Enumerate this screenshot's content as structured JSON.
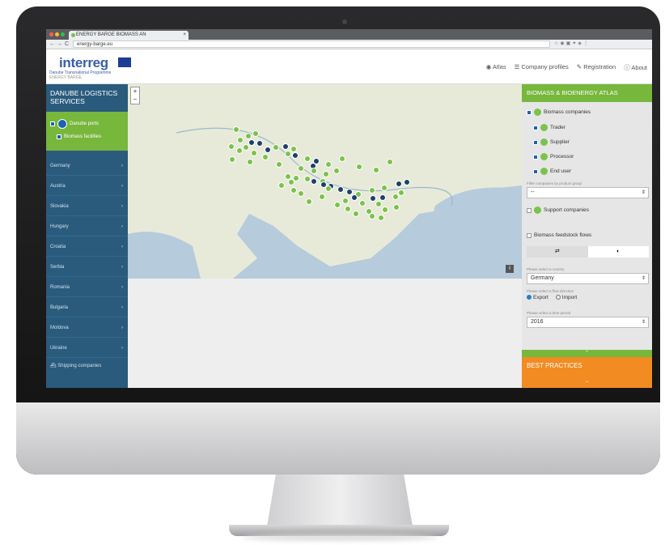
{
  "browser": {
    "tab_title": "ENERGY BARGE BIOMASS AN",
    "tab_close": "×",
    "url": "energy-barge.eu",
    "back": "←",
    "forward": "→",
    "reload": "C"
  },
  "header": {
    "logo_word": "interreg",
    "logo_program": "Danube Transnational Programme",
    "logo_project": "ENERGY BARGE",
    "nav": [
      {
        "icon": "globe-icon",
        "glyph": "◉",
        "label": "Atlas"
      },
      {
        "icon": "list-icon",
        "glyph": "☰",
        "label": "Company profiles"
      },
      {
        "icon": "edit-icon",
        "glyph": "✎",
        "label": "Registration"
      },
      {
        "icon": "info-icon",
        "glyph": "ⓘ",
        "label": "About"
      }
    ]
  },
  "left_sidebar": {
    "title": "DANUBE LOGISTICS SERVICES",
    "layers": [
      {
        "label": "Danube ports",
        "checked": true
      },
      {
        "label": "Biomass facilities",
        "checked": true
      }
    ],
    "countries": [
      "Germany",
      "Austria",
      "Slovakia",
      "Hungary",
      "Croatia",
      "Serbia",
      "Romania",
      "Bulgaria",
      "Moldova",
      "Ukraine"
    ],
    "arrow": "›",
    "shipping_label": "Shipping companies"
  },
  "map": {
    "zoom_in": "+",
    "zoom_out": "−",
    "info": "i",
    "markers": [
      {
        "lat": 50.6,
        "lon": 11.0,
        "type": "green"
      },
      {
        "lat": 50.2,
        "lon": 13.0,
        "type": "green"
      },
      {
        "lat": 49.9,
        "lon": 12.2,
        "type": "green"
      },
      {
        "lat": 49.5,
        "lon": 11.4,
        "type": "green"
      },
      {
        "lat": 49.3,
        "lon": 12.6,
        "type": "blue"
      },
      {
        "lat": 49.2,
        "lon": 13.4,
        "type": "blue"
      },
      {
        "lat": 48.8,
        "lon": 12.0,
        "type": "green"
      },
      {
        "lat": 48.9,
        "lon": 10.5,
        "type": "green"
      },
      {
        "lat": 48.5,
        "lon": 11.3,
        "type": "green"
      },
      {
        "lat": 48.3,
        "lon": 12.8,
        "type": "green"
      },
      {
        "lat": 48.6,
        "lon": 14.2,
        "type": "blue"
      },
      {
        "lat": 48.8,
        "lon": 15.0,
        "type": "green"
      },
      {
        "lat": 48.9,
        "lon": 16.0,
        "type": "blue"
      },
      {
        "lat": 48.7,
        "lon": 16.8,
        "type": "green"
      },
      {
        "lat": 48.2,
        "lon": 16.3,
        "type": "green"
      },
      {
        "lat": 48.0,
        "lon": 17.0,
        "type": "blue"
      },
      {
        "lat": 47.9,
        "lon": 14.0,
        "type": "green"
      },
      {
        "lat": 47.6,
        "lon": 10.6,
        "type": "green"
      },
      {
        "lat": 47.4,
        "lon": 12.4,
        "type": "green"
      },
      {
        "lat": 47.2,
        "lon": 15.4,
        "type": "green"
      },
      {
        "lat": 47.7,
        "lon": 18.2,
        "type": "green"
      },
      {
        "lat": 47.5,
        "lon": 19.1,
        "type": "blue"
      },
      {
        "lat": 47.2,
        "lon": 20.4,
        "type": "green"
      },
      {
        "lat": 47.7,
        "lon": 21.8,
        "type": "green"
      },
      {
        "lat": 47.0,
        "lon": 18.8,
        "type": "blue"
      },
      {
        "lat": 46.8,
        "lon": 17.6,
        "type": "green"
      },
      {
        "lat": 46.5,
        "lon": 18.9,
        "type": "green"
      },
      {
        "lat": 46.2,
        "lon": 20.1,
        "type": "green"
      },
      {
        "lat": 46.5,
        "lon": 21.2,
        "type": "green"
      },
      {
        "lat": 46.9,
        "lon": 23.5,
        "type": "green"
      },
      {
        "lat": 46.6,
        "lon": 25.2,
        "type": "green"
      },
      {
        "lat": 47.4,
        "lon": 26.6,
        "type": "green"
      },
      {
        "lat": 46.0,
        "lon": 16.3,
        "type": "green"
      },
      {
        "lat": 45.8,
        "lon": 17.1,
        "type": "green"
      },
      {
        "lat": 45.7,
        "lon": 18.2,
        "type": "green"
      },
      {
        "lat": 45.5,
        "lon": 18.9,
        "type": "blue"
      },
      {
        "lat": 45.5,
        "lon": 19.8,
        "type": "green"
      },
      {
        "lat": 45.2,
        "lon": 19.9,
        "type": "blue"
      },
      {
        "lat": 45.0,
        "lon": 20.6,
        "type": "blue"
      },
      {
        "lat": 44.8,
        "lon": 20.4,
        "type": "green"
      },
      {
        "lat": 45.4,
        "lon": 16.6,
        "type": "green"
      },
      {
        "lat": 45.1,
        "lon": 15.6,
        "type": "green"
      },
      {
        "lat": 44.6,
        "lon": 16.8,
        "type": "green"
      },
      {
        "lat": 44.3,
        "lon": 17.6,
        "type": "green"
      },
      {
        "lat": 44.7,
        "lon": 21.6,
        "type": "blue"
      },
      {
        "lat": 44.5,
        "lon": 22.5,
        "type": "blue"
      },
      {
        "lat": 44.2,
        "lon": 23.4,
        "type": "green"
      },
      {
        "lat": 44.6,
        "lon": 24.8,
        "type": "green"
      },
      {
        "lat": 44.9,
        "lon": 26.0,
        "type": "green"
      },
      {
        "lat": 45.3,
        "lon": 27.5,
        "type": "blue"
      },
      {
        "lat": 45.4,
        "lon": 28.3,
        "type": "blue"
      },
      {
        "lat": 44.4,
        "lon": 27.8,
        "type": "green"
      },
      {
        "lat": 44.0,
        "lon": 27.2,
        "type": "green"
      },
      {
        "lat": 43.9,
        "lon": 25.9,
        "type": "blue"
      },
      {
        "lat": 43.8,
        "lon": 24.9,
        "type": "blue"
      },
      {
        "lat": 43.9,
        "lon": 23.0,
        "type": "blue"
      },
      {
        "lat": 43.6,
        "lon": 22.1,
        "type": "green"
      },
      {
        "lat": 43.4,
        "lon": 23.8,
        "type": "green"
      },
      {
        "lat": 43.3,
        "lon": 25.5,
        "type": "green"
      },
      {
        "lat": 43.0,
        "lon": 27.3,
        "type": "green"
      },
      {
        "lat": 42.7,
        "lon": 26.1,
        "type": "green"
      },
      {
        "lat": 42.6,
        "lon": 24.5,
        "type": "green"
      },
      {
        "lat": 42.3,
        "lon": 23.2,
        "type": "green"
      },
      {
        "lat": 42.1,
        "lon": 24.8,
        "type": "green"
      },
      {
        "lat": 41.9,
        "lon": 25.7,
        "type": "green"
      },
      {
        "lat": 42.8,
        "lon": 22.3,
        "type": "green"
      },
      {
        "lat": 43.2,
        "lon": 21.3,
        "type": "green"
      },
      {
        "lat": 44.0,
        "lon": 19.7,
        "type": "green"
      },
      {
        "lat": 43.5,
        "lon": 18.4,
        "type": "green"
      }
    ]
  },
  "right_sidebar": {
    "title": "BIOMASS & BIOENERGY ATLAS",
    "biomass_label": "Biomass companies",
    "types": [
      "Trader",
      "Supplier",
      "Processor",
      "End user"
    ],
    "filter_label": "Filter companies by product group",
    "filter_value": "--",
    "support_label": "Support companies",
    "flows_label": "Biomass feedstock flows",
    "toggle_left": "⇄",
    "toggle_right": "◐",
    "country_label": "Please select a country",
    "country_value": "Germany",
    "direction_label": "Please select a flow direction",
    "export_label": "Export",
    "import_label": "Import",
    "period_label": "Please select a time period",
    "period_value": "2016",
    "collapse": "⌃",
    "best_practices": "BEST PRACTICES",
    "expand": "⌄",
    "chevron": "⇕",
    "colors": {
      "green": "#77b73c",
      "orange": "#f28b22",
      "navy": "#2a5b7d"
    }
  }
}
